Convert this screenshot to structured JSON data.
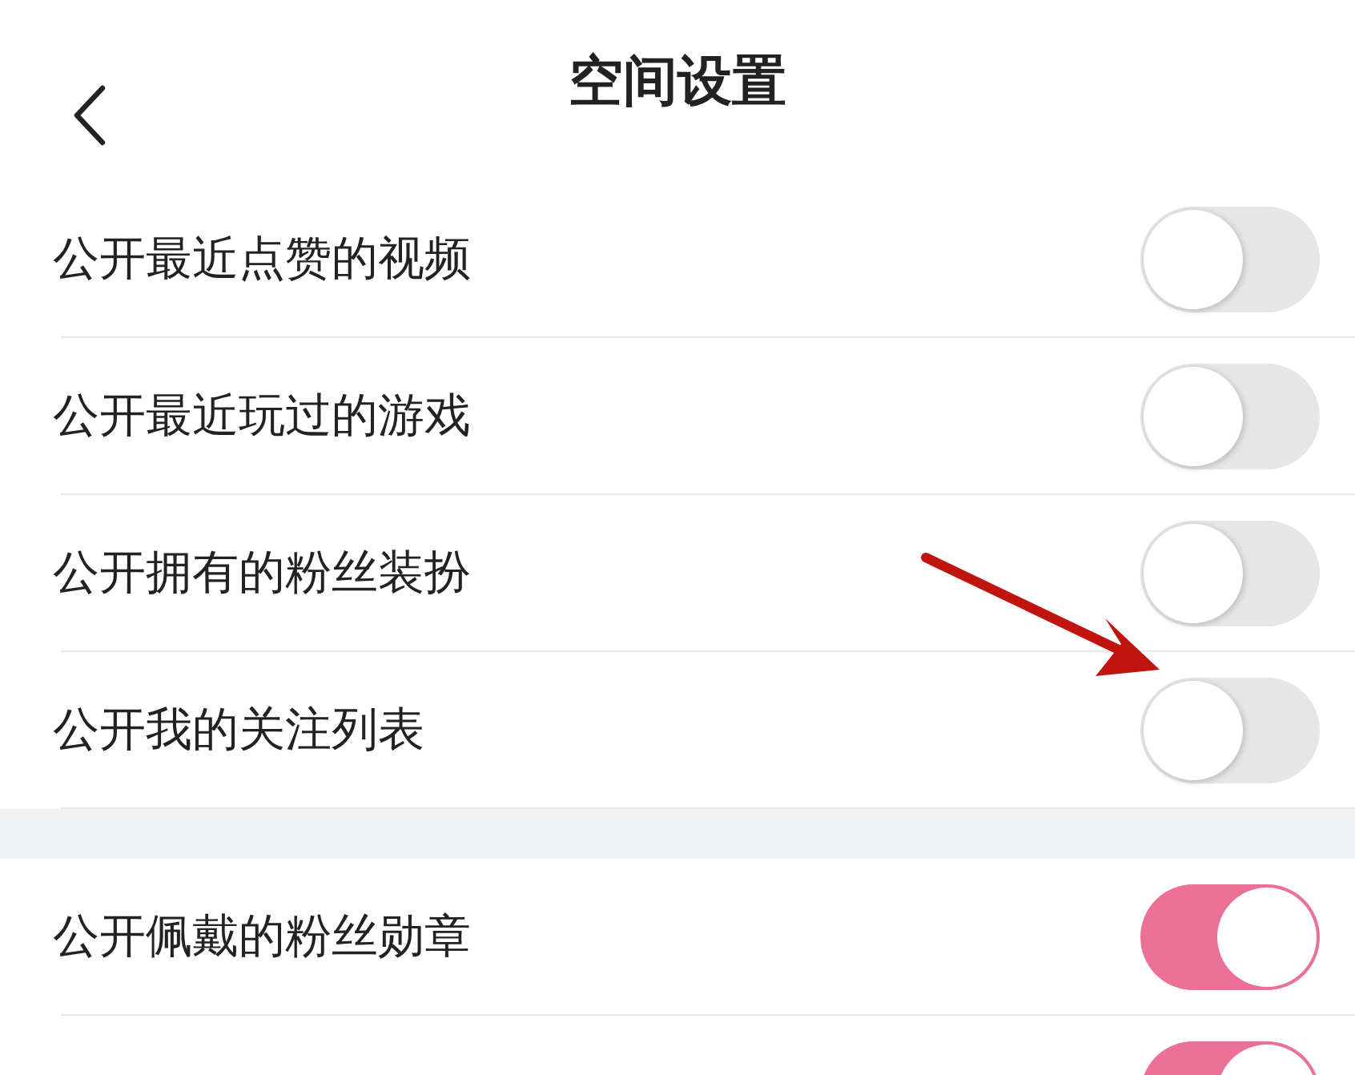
{
  "header": {
    "title": "空间设置"
  },
  "groups": [
    {
      "rows": [
        {
          "label": "公开最近点赞的视频",
          "on": false
        },
        {
          "label": "公开最近玩过的游戏",
          "on": false
        },
        {
          "label": "公开拥有的粉丝装扮",
          "on": false
        },
        {
          "label": "公开我的关注列表",
          "on": false
        }
      ]
    },
    {
      "rows": [
        {
          "label": "公开佩戴的粉丝勋章",
          "on": true
        },
        {
          "on": true
        }
      ]
    }
  ]
}
